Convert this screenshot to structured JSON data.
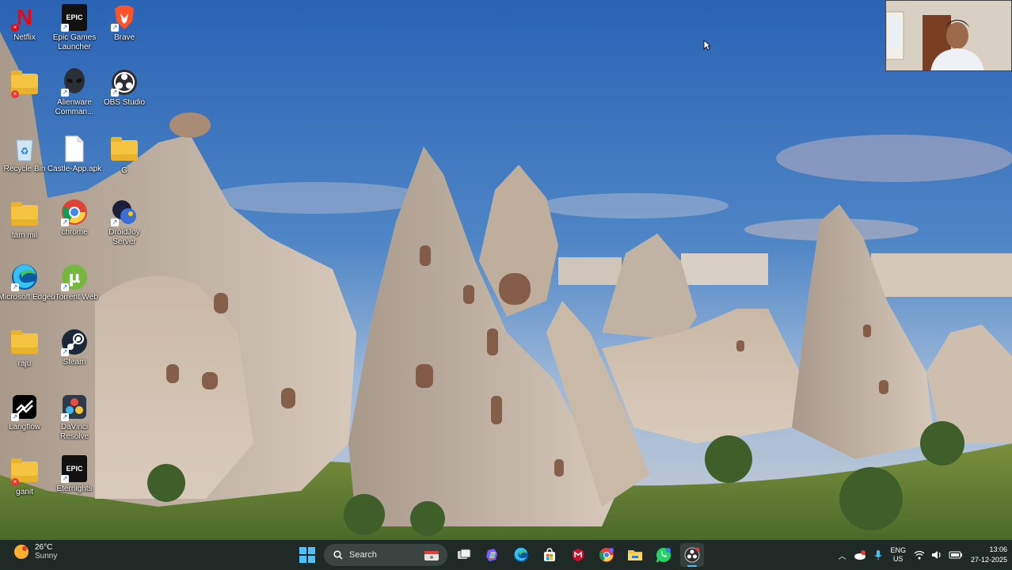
{
  "desktop": {
    "icons": [
      {
        "label": "Netflix",
        "icon": "netflix-icon"
      },
      {
        "label": "Epic Games Launcher",
        "icon": "epic-games-icon"
      },
      {
        "label": "Brave",
        "icon": "brave-icon"
      },
      {
        "label": "",
        "icon": "folder-icon"
      },
      {
        "label": "Alienware Comman...",
        "icon": "alienware-icon"
      },
      {
        "label": "OBS Studio",
        "icon": "obs-icon"
      },
      {
        "label": "Recycle Bin",
        "icon": "recycle-bin-icon"
      },
      {
        "label": "Castle-App.apk",
        "icon": "file-icon"
      },
      {
        "label": "G",
        "icon": "folder-icon"
      },
      {
        "label": "tam mil",
        "icon": "folder-icon"
      },
      {
        "label": "chrome",
        "icon": "chrome-icon"
      },
      {
        "label": "DroidJoy Server",
        "icon": "droidjoy-icon"
      },
      {
        "label": "Microsoft Edge",
        "icon": "edge-icon"
      },
      {
        "label": "uTorrent Web",
        "icon": "utorrent-icon"
      },
      {
        "label": "raju",
        "icon": "folder-icon"
      },
      {
        "label": "Steam",
        "icon": "steam-icon"
      },
      {
        "label": "Langflow",
        "icon": "langflow-icon"
      },
      {
        "label": "DaVinci Resolve",
        "icon": "davinci-icon"
      },
      {
        "label": "ganit",
        "icon": "folder-icon"
      },
      {
        "label": "Eternights",
        "icon": "epic-games-icon"
      }
    ]
  },
  "taskbar": {
    "weather": {
      "temp": "26°C",
      "condition": "Sunny"
    },
    "search_label": "Search",
    "language": {
      "lang": "ENG",
      "region": "US"
    },
    "clock": {
      "time": "13:06",
      "date": "27-12-2025"
    }
  },
  "colors": {
    "taskbar": "#1f2a27",
    "sky": "#3d6fb0",
    "accent": "#0078d4"
  }
}
